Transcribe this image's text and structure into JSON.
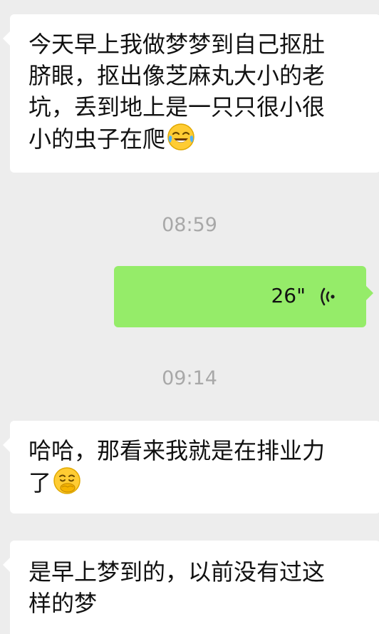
{
  "messages": [
    {
      "side": "incoming",
      "lines": [
        "今天早上我做梦梦到自己抠肚",
        "脐眼，抠出像芝麻丸大小的老",
        "坑，丢到地上是一只只很小很",
        "小的虫子在爬"
      ],
      "emoji": "laughing-crying-emoji"
    },
    {
      "timestamp": "08:59"
    },
    {
      "side": "outgoing",
      "type": "voice",
      "duration": "26\"",
      "icon": "voice-wave-icon"
    },
    {
      "timestamp": "09:14"
    },
    {
      "side": "incoming",
      "lines": [
        "哈哈，那看来我就是在排业力",
        "了"
      ],
      "emoji": "smirking-hand-over-mouth-emoji"
    },
    {
      "side": "incoming",
      "lines": [
        "是早上梦到的，以前没有过这",
        "样的梦"
      ]
    }
  ],
  "colors": {
    "background": "#ededed",
    "incoming_bubble": "#ffffff",
    "outgoing_bubble": "#95ec69",
    "timestamp_text": "#a8a8a8"
  }
}
